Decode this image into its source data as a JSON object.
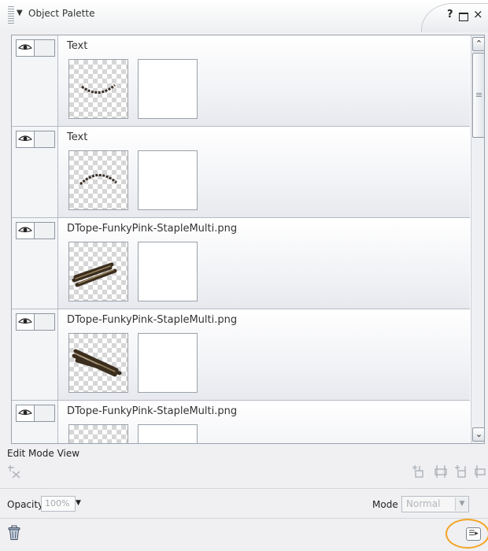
{
  "window": {
    "title": "Object Palette",
    "help_label": "?",
    "colors": {
      "highlight_ring": "#f3a322",
      "panel_bg": "#f0f0f2"
    }
  },
  "layers": [
    {
      "name": "Text",
      "thumb_icon": "arched-text-smile"
    },
    {
      "name": "Text",
      "thumb_icon": "arched-text-rainbow"
    },
    {
      "name": "DTope-FunkyPink-StapleMulti.png",
      "thumb_icon": "staples-brown"
    },
    {
      "name": "DTope-FunkyPink-StapleMulti.png",
      "thumb_icon": "staples-brown"
    },
    {
      "name": "DTope-FunkyPink-StapleMulti.png",
      "thumb_icon": "staples-brown"
    }
  ],
  "edit_mode": {
    "label": "Edit Mode View"
  },
  "opacity": {
    "label": "Opacity",
    "value": "100%"
  },
  "mode": {
    "label": "Mode",
    "value": "Normal"
  }
}
